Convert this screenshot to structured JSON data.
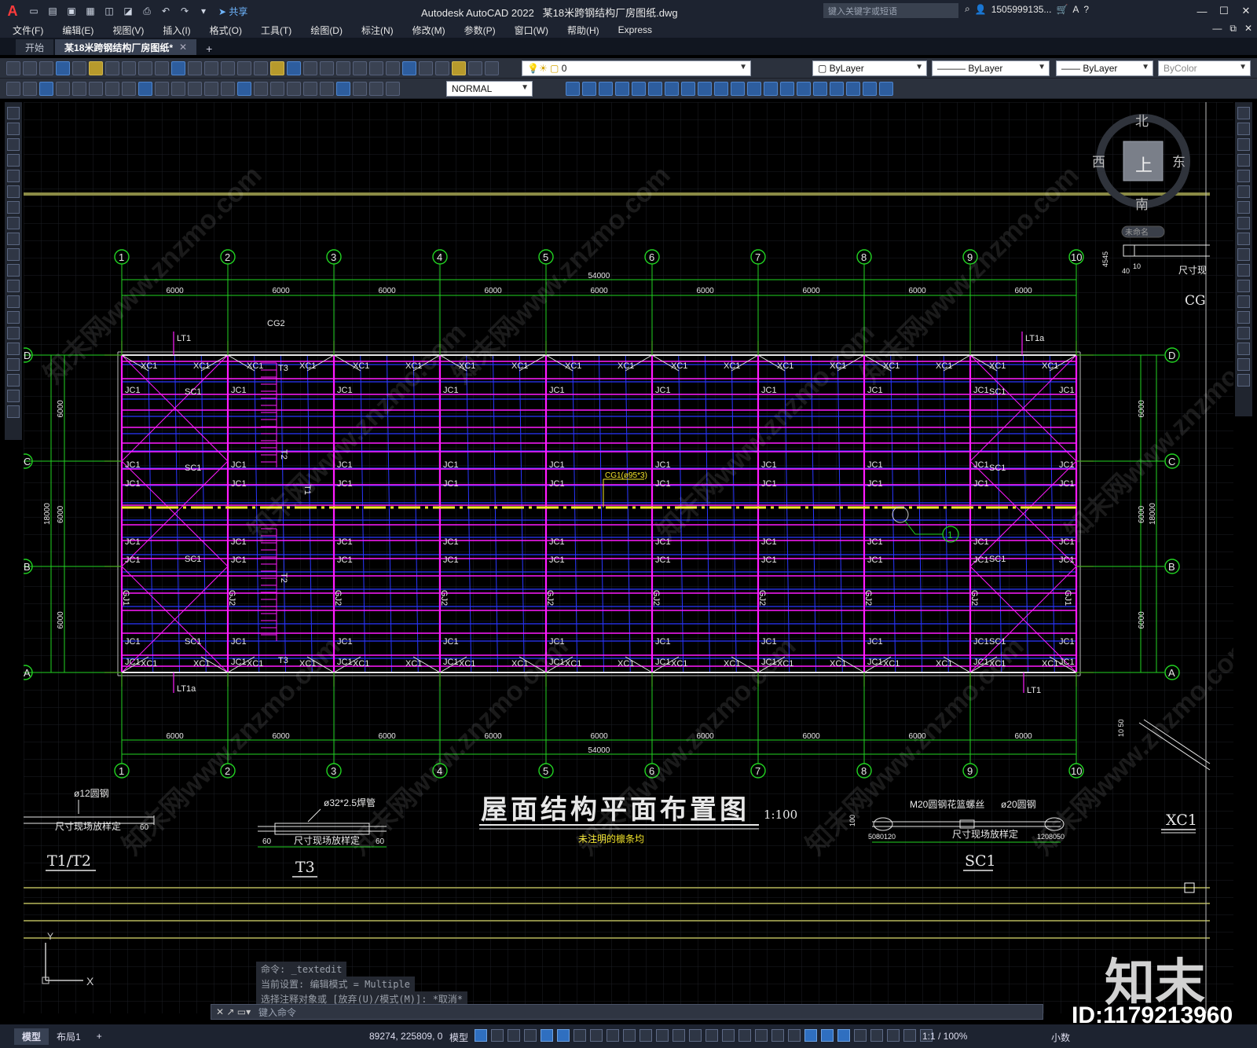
{
  "app": {
    "logo": "A",
    "title": "Autodesk AutoCAD 2022",
    "filename": "某18米跨钢结构厂房图纸.dwg",
    "search_placeholder": "键入关键字或短语",
    "user": "1505999135...",
    "share_label": "共享"
  },
  "menu": [
    "文件(F)",
    "编辑(E)",
    "视图(V)",
    "插入(I)",
    "格式(O)",
    "工具(T)",
    "绘图(D)",
    "标注(N)",
    "修改(M)",
    "参数(P)",
    "窗口(W)",
    "帮助(H)",
    "Express"
  ],
  "tabs": [
    {
      "label": "开始",
      "active": false
    },
    {
      "label": "某18米跨钢结构厂房图纸*",
      "active": true
    }
  ],
  "toolbar": {
    "layer": "0",
    "color": "ByLayer",
    "linetype": "ByLayer",
    "lineweight": "ByLayer",
    "plotstyle": "ByColor",
    "dimstyle": "NORMAL"
  },
  "viewcube": {
    "north": "北",
    "south": "南",
    "east": "东",
    "west": "西",
    "top": "上",
    "wcs": "未命名"
  },
  "drawing": {
    "title": "屋面结构平面布置图",
    "scale": "1:100",
    "note": "未注明的檩条均",
    "total_length": "54000",
    "bay": "6000",
    "depth_total": "18000",
    "axes_x": [
      "1",
      "2",
      "3",
      "4",
      "5",
      "6",
      "7",
      "8",
      "9",
      "10"
    ],
    "axes_y": [
      "D",
      "C",
      "B",
      "A"
    ],
    "labels": {
      "xc1": "XC1",
      "jc1": "JC1",
      "sc1": "SC1",
      "lt1": "LT1",
      "lt1a": "LT1a",
      "cg2": "CG2",
      "cg1": "CG1(ø95*3)",
      "t1": "T1",
      "t2": "T2",
      "t3": "T3",
      "gj1": "GJ1",
      "gj2": "GJ2",
      "callout": "1"
    },
    "details": {
      "t1t2_rod": "ø12圆钢",
      "t1t2_note": "尺寸现场放样定",
      "t1t2_dim": "60",
      "t1t2_title": "T1/T2",
      "t3_pipe": "ø32*2.5焊管",
      "t3_note": "尺寸现场放样定",
      "t3_dim": "60",
      "t3_title": "T3",
      "sc1_bolt": "M20圆钢花篮螺丝",
      "sc1_rod": "ø20圆钢",
      "sc1_note": "尺寸现场放样定",
      "sc1_title": "SC1",
      "sc1_dim_l": "5080120",
      "sc1_dim_r": "1208050",
      "sc1_side": "100",
      "xc1_title": "XC1",
      "right_dims": "4545",
      "right_dim2": "40",
      "right_dim3": "10",
      "right_note": "尺寸现",
      "right_cg": "CG",
      "right_1050": "10 50"
    }
  },
  "command": {
    "history": [
      "命令: _textedit",
      "当前设置: 编辑模式 = Multiple",
      "选择注释对象或 [放弃(U)/模式(M)]: *取消*"
    ],
    "placeholder": "键入命令"
  },
  "status": {
    "layouts": [
      "模型",
      "布局1"
    ],
    "coords": "89274, 225809, 0",
    "model": "模型",
    "scale": "1:1 / 100%",
    "units": "小数"
  },
  "watermark": {
    "logo": "知末",
    "id": "ID:1179213960",
    "text": "知末网www.znzmo.com"
  },
  "colors": {
    "background": "#000000",
    "axis_green": "#22d322",
    "beam_magenta": "#ff1aff",
    "purlin_blue": "#2a36ff",
    "axis_red": "#d01919",
    "tie_yellow": "#f5e62a",
    "frame_white": "#e8e8e8"
  }
}
